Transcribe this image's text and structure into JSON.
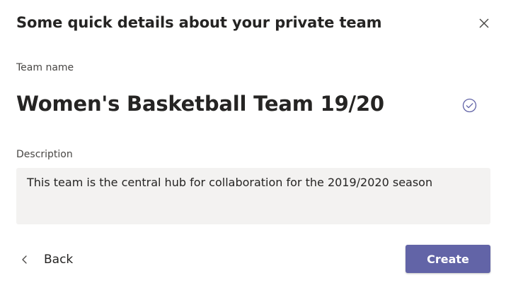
{
  "dialog": {
    "title": "Some quick details about your private team",
    "close_icon": "close-icon"
  },
  "team_name": {
    "label": "Team name",
    "value": "Women's Basketball Team 19/20",
    "status_icon": "check-circle-icon"
  },
  "description": {
    "label": "Description",
    "value": "This team is the central hub for collaboration for the 2019/2020 season"
  },
  "footer": {
    "back_label": "Back",
    "back_icon": "chevron-left-icon",
    "create_label": "Create"
  },
  "colors": {
    "accent": "#6264a7",
    "field_background": "#f3f2f1",
    "text": "#252423"
  }
}
